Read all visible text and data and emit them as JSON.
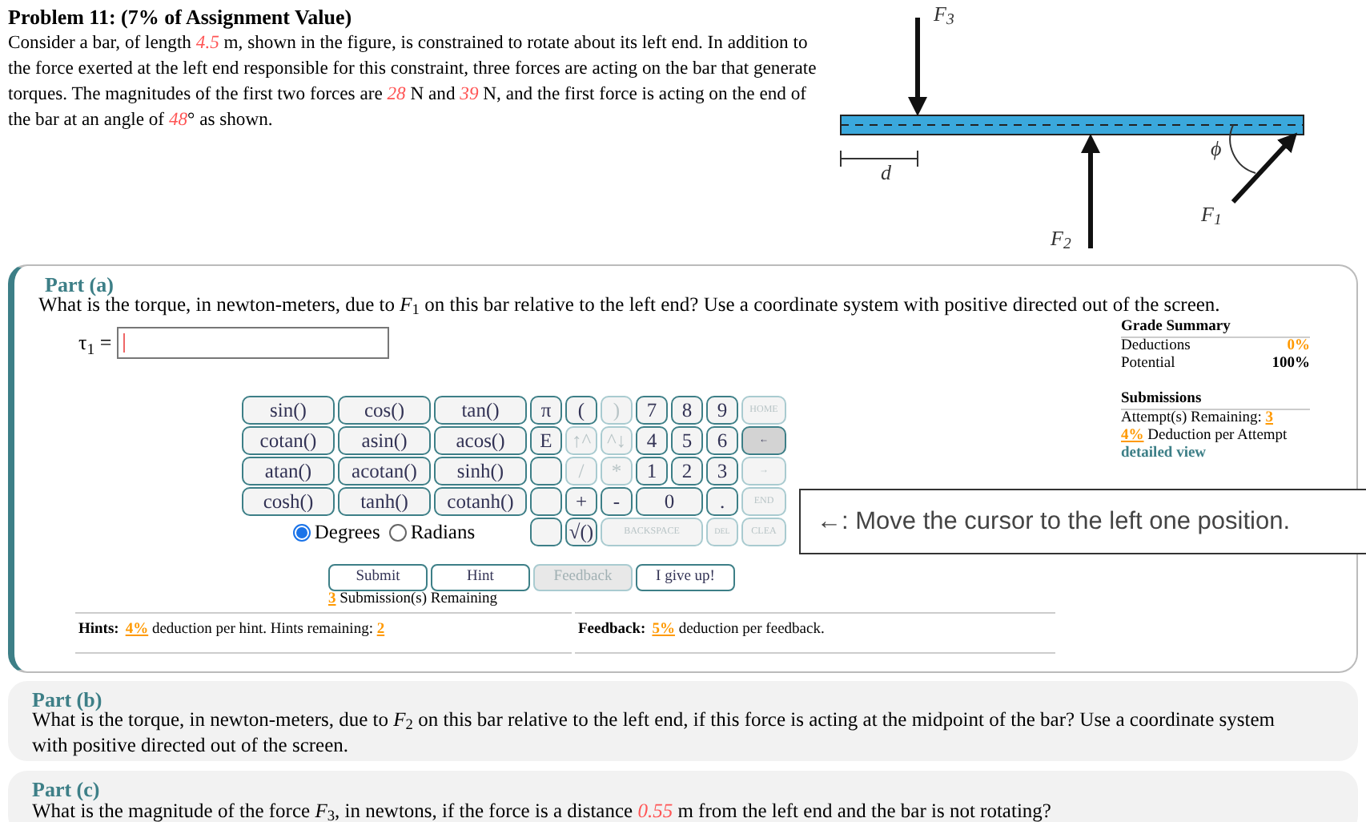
{
  "problem": {
    "title": "Problem 11: (7% of Assignment Value)",
    "text": [
      {
        "text": " Consider a bar, of length ",
        "kind": "plain"
      },
      {
        "text": "4.5",
        "kind": "value"
      },
      {
        "text": " m, shown in the figure, is constrained to rotate about its left end. In addition to the force exerted at the left end responsible for this constraint, three forces are acting on the bar that generate torques. The magnitudes of the first two forces are ",
        "kind": "plain"
      },
      {
        "text": "28",
        "kind": "value"
      },
      {
        "text": " N and ",
        "kind": "plain"
      },
      {
        "text": "39",
        "kind": "value"
      },
      {
        "text": " N, and the first force is acting on the end of the bar at an angle of ",
        "kind": "plain"
      },
      {
        "text": "48",
        "kind": "value"
      },
      {
        "text": "° as shown.",
        "kind": "plain"
      }
    ]
  },
  "figure": {
    "labels": [
      {
        "text": "F$_{3}$"
      },
      {
        "text": "d"
      },
      {
        "text": "F$_{2}$"
      },
      {
        "text": "F$_{1}$"
      },
      {
        "text": "ϕ"
      }
    ]
  },
  "part_a": {
    "title": "Part (a)",
    "question": [
      {
        "text": "What is the torque, in newton-meters, due to *F*$_{1}$ on this bar relative to the left end? Use a coordinate system with positive directed out of the screen.",
        "kind": "plain"
      }
    ],
    "answer_label": "τ$_{1}$ =",
    "keypad": [
      [
        {
          "label": "sin()",
          "kind": "func",
          "disabled": false,
          "highlighted": false
        },
        {
          "label": "cos()",
          "kind": "func",
          "disabled": false,
          "highlighted": false
        },
        {
          "label": "tan()",
          "kind": "func",
          "disabled": false,
          "highlighted": false
        },
        {
          "label": "π",
          "kind": "key",
          "disabled": false,
          "highlighted": false
        },
        {
          "label": "(",
          "kind": "key",
          "disabled": false,
          "highlighted": false
        },
        {
          "label": ")",
          "kind": "key",
          "disabled": true,
          "highlighted": false
        },
        {
          "label": "7",
          "kind": "key",
          "disabled": false,
          "highlighted": false
        },
        {
          "label": "8",
          "kind": "key",
          "disabled": false,
          "highlighted": false
        },
        {
          "label": "9",
          "kind": "key",
          "disabled": false,
          "highlighted": false
        },
        {
          "label": "HOME",
          "kind": "nav",
          "disabled": true,
          "highlighted": false
        }
      ],
      [
        {
          "label": "cotan()",
          "kind": "func",
          "disabled": false,
          "highlighted": false
        },
        {
          "label": "asin()",
          "kind": "func",
          "disabled": false,
          "highlighted": false
        },
        {
          "label": "acos()",
          "kind": "func",
          "disabled": false,
          "highlighted": false
        },
        {
          "label": "E",
          "kind": "key",
          "disabled": false,
          "highlighted": false
        },
        {
          "label": "↑^",
          "kind": "key",
          "disabled": true,
          "highlighted": false
        },
        {
          "label": "^↓",
          "kind": "key",
          "disabled": true,
          "highlighted": false
        },
        {
          "label": "4",
          "kind": "key",
          "disabled": false,
          "highlighted": false
        },
        {
          "label": "5",
          "kind": "key",
          "disabled": false,
          "highlighted": false
        },
        {
          "label": "6",
          "kind": "key",
          "disabled": false,
          "highlighted": false
        },
        {
          "label": "←",
          "kind": "nav",
          "disabled": false,
          "highlighted": true
        }
      ],
      [
        {
          "label": "atan()",
          "kind": "func",
          "disabled": false,
          "highlighted": false
        },
        {
          "label": "acotan()",
          "kind": "func",
          "disabled": false,
          "highlighted": false
        },
        {
          "label": "sinh()",
          "kind": "func",
          "disabled": false,
          "highlighted": false
        },
        {
          "kind": "blank",
          "disabled": false,
          "highlighted": false
        },
        {
          "label": "/",
          "kind": "key",
          "disabled": true,
          "highlighted": false
        },
        {
          "label": "*",
          "kind": "key",
          "disabled": true,
          "highlighted": false
        },
        {
          "label": "1",
          "kind": "key",
          "disabled": false,
          "highlighted": false
        },
        {
          "label": "2",
          "kind": "key",
          "disabled": false,
          "highlighted": false
        },
        {
          "label": "3",
          "kind": "key",
          "disabled": false,
          "highlighted": false
        },
        {
          "label": "→",
          "kind": "nav",
          "disabled": true,
          "highlighted": false
        }
      ],
      [
        {
          "label": "cosh()",
          "kind": "func",
          "disabled": false,
          "highlighted": false
        },
        {
          "label": "tanh()",
          "kind": "func",
          "disabled": false,
          "highlighted": false
        },
        {
          "label": "cotanh()",
          "kind": "func",
          "disabled": false,
          "highlighted": false
        },
        {
          "kind": "blank",
          "disabled": false,
          "highlighted": false
        },
        {
          "label": "+",
          "kind": "key",
          "disabled": false,
          "highlighted": false
        },
        {
          "label": "-",
          "kind": "key",
          "disabled": false,
          "highlighted": false
        },
        {
          "label": "0",
          "kind": "wide",
          "disabled": false,
          "highlighted": false
        },
        {
          "label": ".",
          "kind": "key",
          "disabled": false,
          "highlighted": false
        },
        {
          "label": "END",
          "kind": "nav",
          "disabled": true,
          "highlighted": false
        }
      ],
      [
        {
          "kind": "radios"
        },
        {
          "kind": "blank",
          "disabled": false,
          "highlighted": false
        },
        {
          "label": "√()",
          "kind": "key",
          "disabled": false,
          "highlighted": false
        },
        {
          "label": "BACKSPACE",
          "kind": "long",
          "disabled": true,
          "highlighted": false
        },
        {
          "label": "DEL",
          "kind": "small",
          "disabled": true,
          "highlighted": false
        },
        {
          "label": "CLEA",
          "kind": "nav",
          "disabled": true,
          "highlighted": false
        }
      ]
    ],
    "angle_modes": [
      {
        "label": "Degrees",
        "selected": true
      },
      {
        "label": "Radians",
        "selected": false
      }
    ],
    "actions": [
      {
        "label": "Submit",
        "disabled": false
      },
      {
        "label": "Hint",
        "disabled": false
      },
      {
        "label": "Feedback",
        "disabled": true
      },
      {
        "label": "I give up!",
        "disabled": false
      }
    ],
    "submissions_line": [
      {
        "text": "3",
        "kind": "pct"
      },
      {
        "text": " Submission(s) Remaining",
        "kind": "plain"
      }
    ],
    "hints_line": [
      {
        "text": "Hints:",
        "kind": "label"
      },
      {
        "text": "4%",
        "kind": "pct"
      },
      {
        "text": " deduction per hint. Hints remaining: ",
        "kind": "plain"
      },
      {
        "text": "2",
        "kind": "pct"
      }
    ],
    "feedback_line": [
      {
        "text": "Feedback:",
        "kind": "label"
      },
      {
        "text": "5%",
        "kind": "pct"
      },
      {
        "text": " deduction per feedback.",
        "kind": "plain"
      }
    ],
    "grade_summary": {
      "title": "Grade Summary",
      "rows": [
        {
          "label": "Deductions",
          "value": "0%",
          "kind": "pct"
        },
        {
          "label": "Potential",
          "value": "100%",
          "kind": "label"
        }
      ]
    },
    "submissions": {
      "title": "Submissions",
      "lines": [
        [
          {
            "text": "Attempt(s) Remaining: ",
            "kind": "plain"
          },
          {
            "text": "3",
            "kind": "pct"
          }
        ],
        [
          {
            "text": "4%",
            "kind": "pct"
          },
          {
            "text": " Deduction per Attempt",
            "kind": "plain"
          }
        ]
      ],
      "link": "detailed view"
    }
  },
  "tooltip": "←: Move the cursor to the left one position.",
  "part_b": {
    "title": "Part (b)",
    "question": [
      {
        "text": "What is the torque, in newton-meters, due to *F*$_{2}$ on this bar relative to the left end, if this force is acting at the midpoint of the bar? Use a coordinate system with positive directed out of the screen.",
        "kind": "plain"
      }
    ]
  },
  "part_c": {
    "title": "Part (c)",
    "question": [
      {
        "text": "What is the magnitude of the force *F*$_{3}$, in newtons, if the force is a distance ",
        "kind": "plain"
      },
      {
        "text": "0.55",
        "kind": "value"
      },
      {
        "text": " m from the left end and the bar is not rotating?",
        "kind": "plain"
      }
    ]
  }
}
